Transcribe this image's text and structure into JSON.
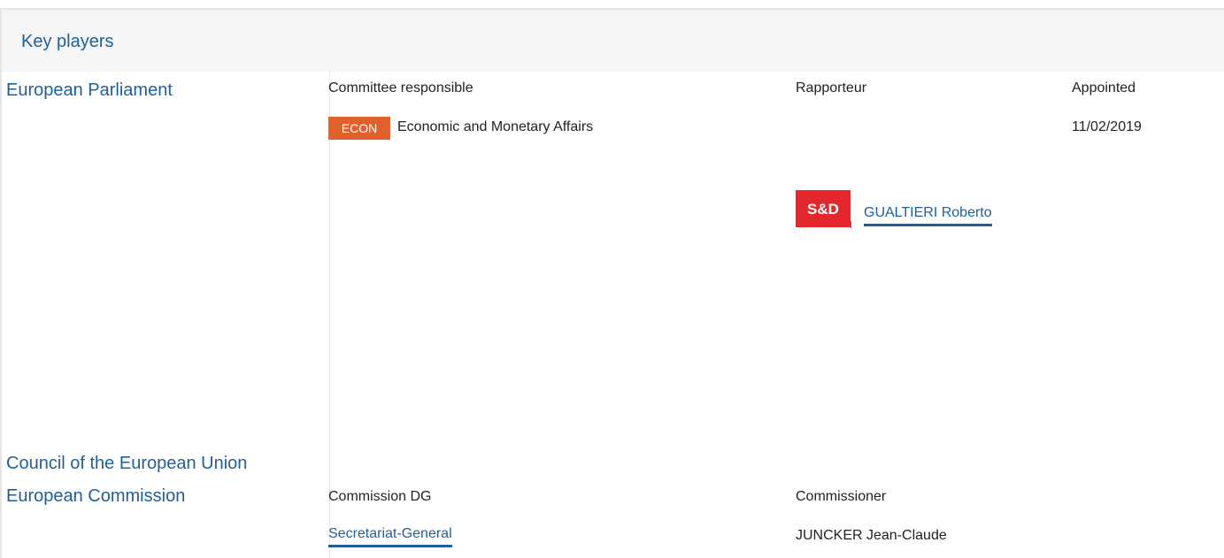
{
  "section": {
    "title": "Key players"
  },
  "ep": {
    "institution": "European Parliament",
    "headers": {
      "committee": "Committee responsible",
      "rapporteur": "Rapporteur",
      "appointed": "Appointed"
    },
    "committee_badge": "ECON",
    "committee_name": "Economic and Monetary Affairs",
    "appointed_date": "11/02/2019",
    "group_logo": "S&D",
    "rapporteur_name": "GUALTIERI Roberto"
  },
  "council": {
    "institution": "Council of the European Union"
  },
  "commission": {
    "institution": "European Commission",
    "headers": {
      "dg": "Commission DG",
      "commissioner": "Commissioner"
    },
    "dg_name": "Secretariat-General",
    "commissioner_name": "JUNCKER Jean-Claude"
  },
  "colors": {
    "link": "#215f9a",
    "badge": "#e0612b",
    "logo": "#e3272c"
  }
}
